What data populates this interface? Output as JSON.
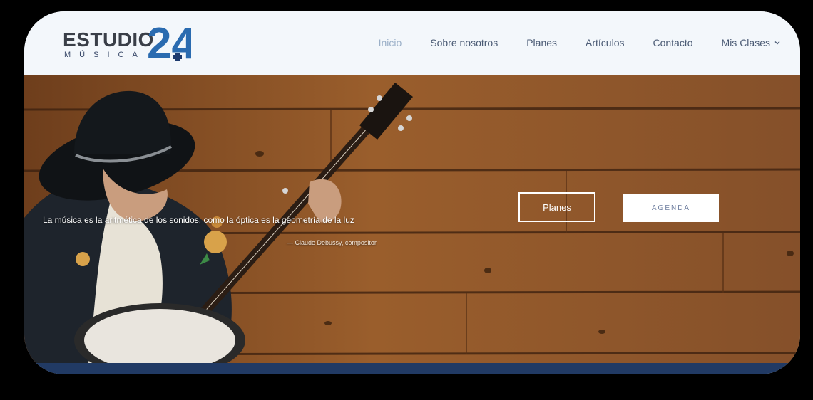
{
  "brand": {
    "name": "ESTUDIO",
    "subtitle": "MÚSICA",
    "number": "24",
    "colors": {
      "dark": "#3a3f48",
      "accent": "#2a6bb0",
      "navy": "#1d3a6e"
    }
  },
  "nav": {
    "items": [
      {
        "label": "Inicio",
        "active": true
      },
      {
        "label": "Sobre nosotros"
      },
      {
        "label": "Planes"
      },
      {
        "label": "Artículos"
      },
      {
        "label": "Contacto"
      }
    ],
    "dropdown": {
      "label": "Mis Clases",
      "icon": "chevron-down-icon"
    }
  },
  "hero": {
    "quote": "La música es la aritmética de los sonidos, como la óptica es la geometría de la luz",
    "cite": "— Claude Debussy, compositor",
    "buttons": {
      "plans": "Planes",
      "agenda": "AGENDA"
    },
    "image": "banjo-player-photo"
  },
  "colors": {
    "header_bg": "#f3f7fb",
    "nav_text": "#4a5a74",
    "nav_active": "#9bb0c8",
    "wood": "#8a5228",
    "footer_strip": "#213a64"
  }
}
